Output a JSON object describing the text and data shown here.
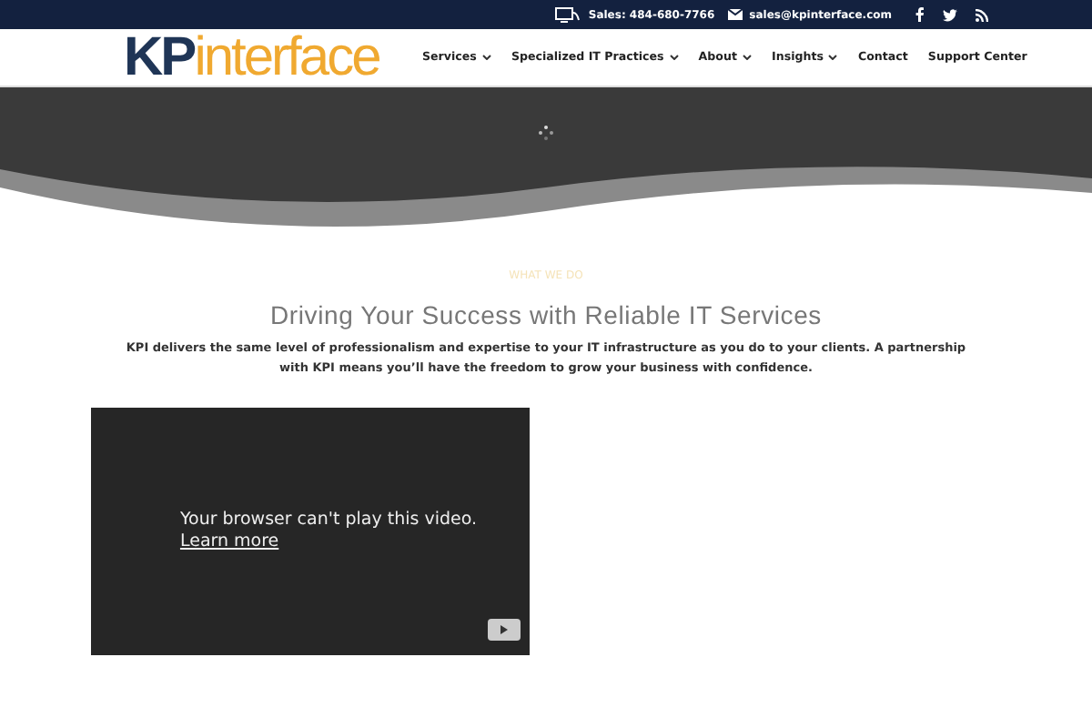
{
  "top_bar": {
    "phone": "Sales: 484-680-7766",
    "email": "sales@kpinterface.com"
  },
  "logo": {
    "part_1": "KP",
    "part_2": "interface"
  },
  "nav": [
    {
      "label": "Services",
      "has_dropdown": true
    },
    {
      "label": "Specialized IT Practices",
      "has_dropdown": true
    },
    {
      "label": "About",
      "has_dropdown": true
    },
    {
      "label": "Insights",
      "has_dropdown": true
    },
    {
      "label": "Contact",
      "has_dropdown": false
    },
    {
      "label": "Support Center",
      "has_dropdown": false
    }
  ],
  "section": {
    "eyebrow": "WHAT WE DO",
    "heading": "Driving Your Success with Reliable IT Services",
    "text": "KPI delivers the same level of professionalism and expertise to your IT infrastructure as you do to your clients. A partnership with KPI means you’ll have the freedom to grow your business with confidence."
  },
  "video": {
    "message": "Your browser can't play this video.",
    "link": "Learn more"
  }
}
